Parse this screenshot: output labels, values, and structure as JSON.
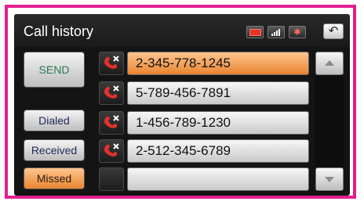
{
  "header": {
    "title": "Call history"
  },
  "status_icons": [
    "battery-icon",
    "signal-icon",
    "bluetooth-icon"
  ],
  "buttons": {
    "send": "SEND",
    "dialed": "Dialed",
    "received": "Received",
    "missed": "Missed"
  },
  "calls": [
    {
      "number": "2-345-778-1245",
      "selected": true
    },
    {
      "number": "5-789-456-7891",
      "selected": false
    },
    {
      "number": "1-456-789-1230",
      "selected": false
    },
    {
      "number": "2-512-345-6789",
      "selected": false
    },
    {
      "number": "",
      "selected": false
    }
  ],
  "colors": {
    "frame": "#e21f8f",
    "selected": "#f0a35e",
    "send_text": "#2a7a55",
    "missed_icon": "#e3322b"
  }
}
